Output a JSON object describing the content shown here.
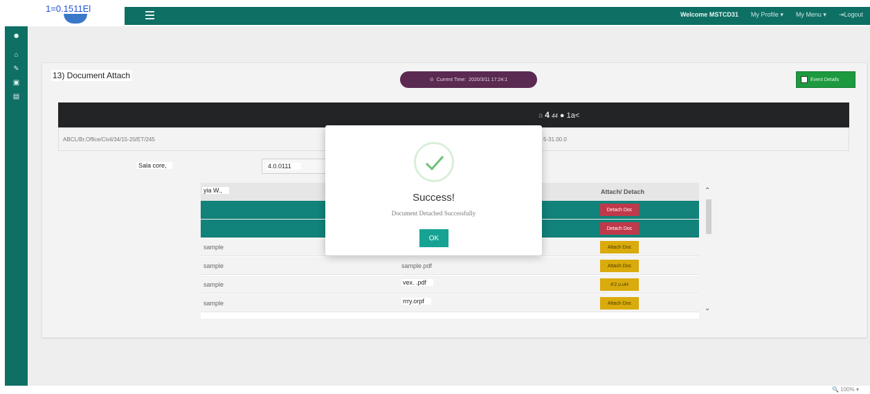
{
  "header": {
    "logo_text": "1=0.1511El",
    "welcome": "Welcome MSTCD31",
    "menu": [
      "My Profile",
      "My Menu"
    ],
    "logout": "Logout"
  },
  "page": {
    "title": "13) Document Attach",
    "current_time_label": "Current Time:",
    "current_time_value": "2020/3/11 17:24:1",
    "event_details": "Event Details"
  },
  "dark_bar": {
    "text_prefix": "a",
    "text_bold": "4",
    "text_small": "44",
    "text_suffix": "1a<"
  },
  "info_row": {
    "left": "ABCL/Br.Office/Civil/34/15-20/ET/245",
    "right": "5-31.00.0"
  },
  "filter": {
    "label": "Sala core,",
    "value": "4.0.0111"
  },
  "table": {
    "headers": [
      "yia W.,",
      "Attach/ Detach"
    ],
    "rows": [
      {
        "name": "",
        "file": "",
        "action": "Detach Doc",
        "type": "detach",
        "selected": true
      },
      {
        "name": "",
        "file": "",
        "action": "Detach Doc",
        "type": "detach",
        "selected": true
      },
      {
        "name": "sample",
        "file": "",
        "action": "Attach Doc",
        "type": "attach",
        "selected": false
      },
      {
        "name": "sample",
        "file": "sample.pdf",
        "action": "Attach Doc",
        "type": "attach",
        "selected": false
      },
      {
        "name": "sample",
        "file": "vex. .pdf",
        "action": "4'2.u.uH",
        "type": "attach",
        "selected": false
      },
      {
        "name": "sample",
        "file": "rrry.orpf",
        "action": "Attach Doc",
        "type": "attach",
        "selected": false
      }
    ]
  },
  "modal": {
    "title": "Success!",
    "message": "Document Detached Successfully",
    "ok": "OK"
  },
  "zoom": "100%"
}
